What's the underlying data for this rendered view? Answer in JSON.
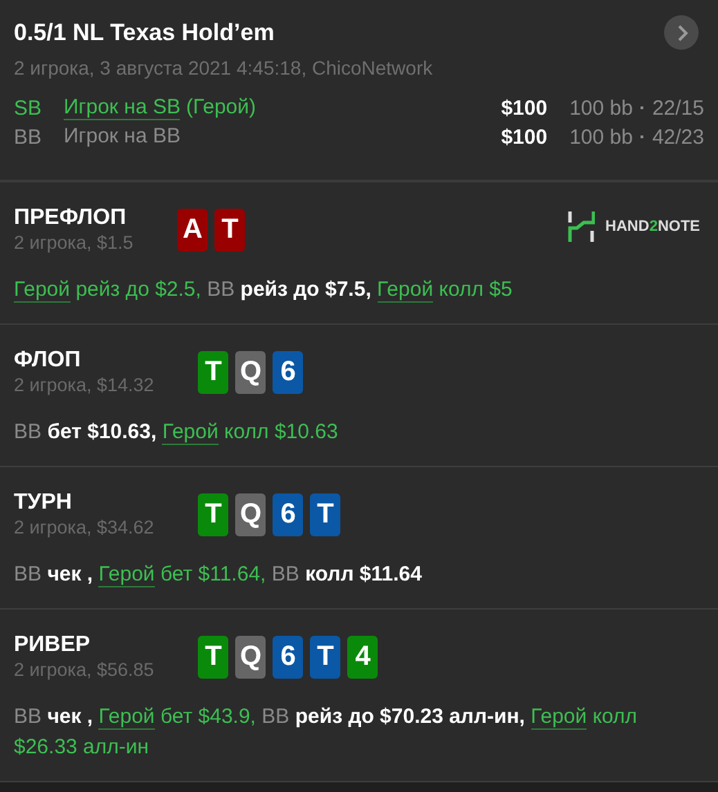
{
  "header": {
    "title": "0.5/1 NL Texas Hold’em",
    "subtitle": "2 игрока, 3 августа 2021 4:45:18, ChicoNetwork",
    "players": [
      {
        "position": "SB",
        "name": "Игрок на SB",
        "hero_tag": "(Герой)",
        "hero": true,
        "stack": "$100",
        "bb": "100 bb",
        "stats": "22/15"
      },
      {
        "position": "BB",
        "name": "Игрок на BB",
        "hero": false,
        "stack": "$100",
        "bb": "100 bb",
        "stats": "42/23"
      }
    ]
  },
  "logo": [
    "HAND",
    "2",
    "NOTE"
  ],
  "streets": [
    {
      "name": "ПРЕФЛОП",
      "info": "2 игрока, $1.5",
      "cards": [
        {
          "rank": "A",
          "color": "#990000"
        },
        {
          "rank": "T",
          "color": "#990000"
        }
      ],
      "actions": [
        {
          "player": "Герой",
          "hero": true,
          "text": "рейз до $2.5,"
        },
        {
          "player": "BB",
          "hero": false,
          "text": "рейз до $7.5,"
        },
        {
          "player": "Герой",
          "hero": true,
          "text": "колл $5"
        }
      ]
    },
    {
      "name": "ФЛОП",
      "info": "2 игрока, $14.32",
      "cards": [
        {
          "rank": "T",
          "color": "#0a8a0a"
        },
        {
          "rank": "Q",
          "color": "#666666"
        },
        {
          "rank": "6",
          "color": "#0b58a6"
        }
      ],
      "actions": [
        {
          "player": "BB",
          "hero": false,
          "text": "бет $10.63,"
        },
        {
          "player": "Герой",
          "hero": true,
          "text": "колл $10.63"
        }
      ]
    },
    {
      "name": "ТУРН",
      "info": "2 игрока, $34.62",
      "cards": [
        {
          "rank": "T",
          "color": "#0a8a0a"
        },
        {
          "rank": "Q",
          "color": "#666666"
        },
        {
          "rank": "6",
          "color": "#0b58a6"
        },
        {
          "rank": "T",
          "color": "#0b58a6"
        }
      ],
      "actions": [
        {
          "player": "BB",
          "hero": false,
          "text": "чек ,"
        },
        {
          "player": "Герой",
          "hero": true,
          "text": "бет $11.64,"
        },
        {
          "player": "BB",
          "hero": false,
          "text": "колл $11.64"
        }
      ]
    },
    {
      "name": "РИВЕР",
      "info": "2 игрока, $56.85",
      "cards": [
        {
          "rank": "T",
          "color": "#0a8a0a"
        },
        {
          "rank": "Q",
          "color": "#666666"
        },
        {
          "rank": "6",
          "color": "#0b58a6"
        },
        {
          "rank": "T",
          "color": "#0b58a6"
        },
        {
          "rank": "4",
          "color": "#0a8a0a"
        }
      ],
      "actions": [
        {
          "player": "BB",
          "hero": false,
          "text": "чек ,"
        },
        {
          "player": "Герой",
          "hero": true,
          "text": "бет $43.9,"
        },
        {
          "player": "BB",
          "hero": false,
          "text": "рейз до $70.23 алл-ин,"
        },
        {
          "player": "Герой",
          "hero": true,
          "text": "колл $26.33 алл-ин"
        }
      ]
    }
  ]
}
